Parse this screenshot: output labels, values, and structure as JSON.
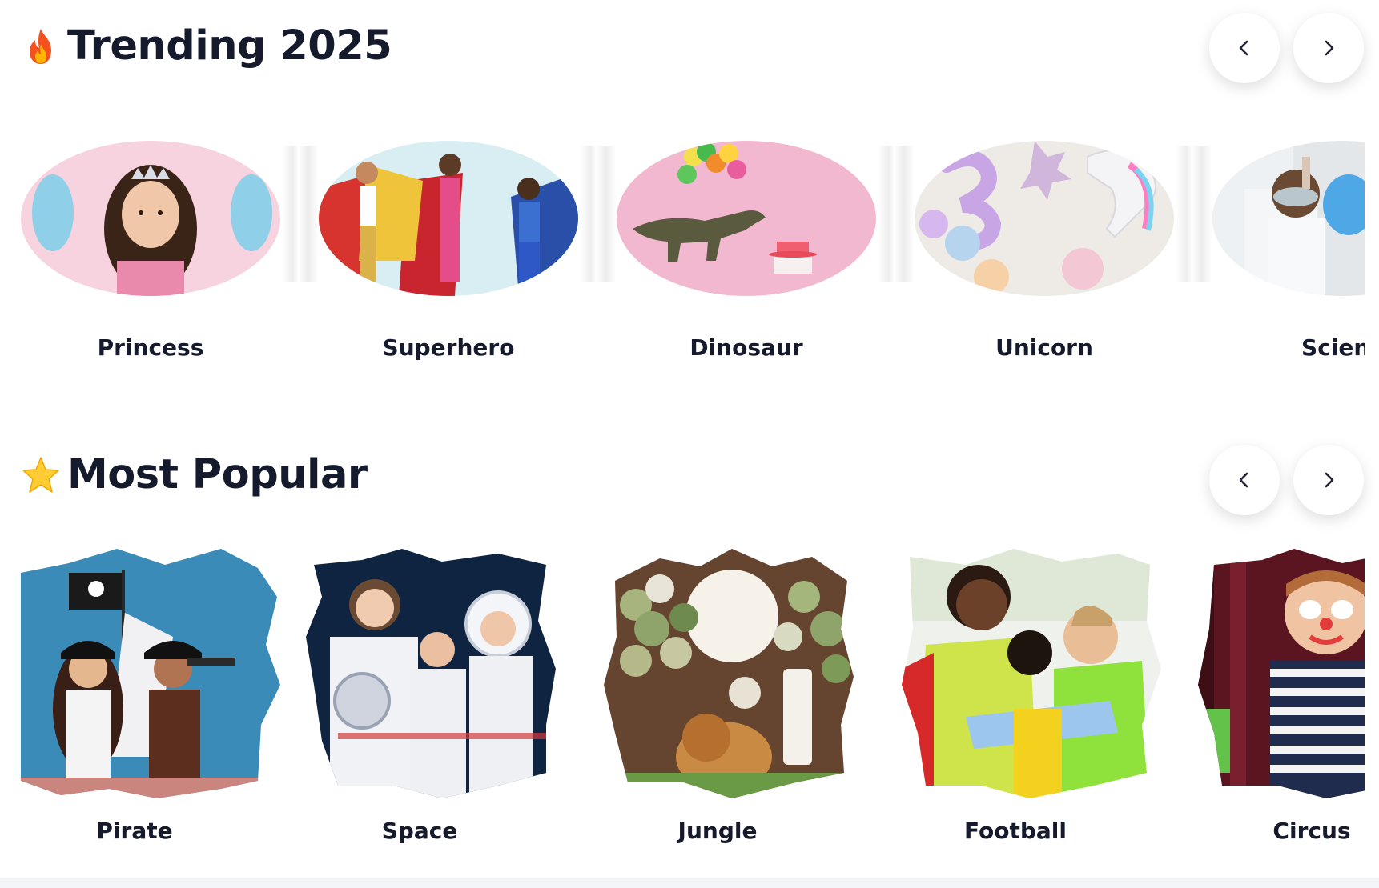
{
  "trending": {
    "icon": "fire-icon",
    "title": "Trending 2025",
    "items": [
      {
        "label": "Princess"
      },
      {
        "label": "Superhero"
      },
      {
        "label": "Dinosaur"
      },
      {
        "label": "Unicorn"
      },
      {
        "label": "Scienc"
      }
    ]
  },
  "popular": {
    "icon": "star-icon",
    "title": "Most Popular",
    "items": [
      {
        "label": "Pirate"
      },
      {
        "label": "Space"
      },
      {
        "label": "Jungle"
      },
      {
        "label": "Football"
      },
      {
        "label": "Circus"
      }
    ]
  },
  "nav": {
    "prev_icon": "chevron-left-icon",
    "next_icon": "chevron-right-icon"
  },
  "colors": {
    "text": "#151a2d",
    "princess_bg": "#f6c9d8",
    "superhero_bg": "#dceff3",
    "dinosaur_bg": "#f2b5cf",
    "unicorn_bg": "#eeeae6",
    "science_bg": "#dfe3e6",
    "pirate_bg": "#3a8bb8",
    "space_bg": "#0e2340",
    "jungle_bg": "#6b4a33",
    "football_bg": "#e9efe6",
    "circus_bg": "#5a1521"
  }
}
